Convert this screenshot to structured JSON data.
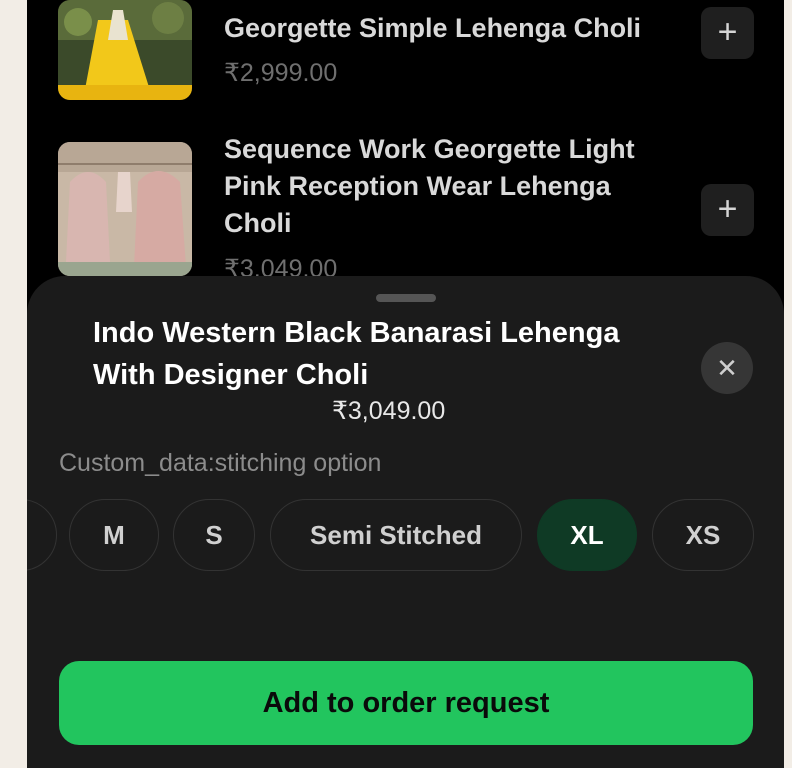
{
  "products": [
    {
      "title": "Georgette Simple Lehenga Choli",
      "price": "₹2,999.00",
      "add_icon": "plus-icon"
    },
    {
      "title": "Sequence Work Georgette Light Pink Reception Wear Lehenga Choli",
      "price": "₹3,049.00",
      "add_icon": "plus-icon"
    }
  ],
  "sheet": {
    "title": "Indo Western Black Banarasi Lehenga With Designer Choli",
    "price": "₹3,049.00",
    "close_glyph": "✕",
    "option_label": "Custom_data:stitching option",
    "options": [
      "",
      "M",
      "S",
      "Semi Stitched",
      "XL",
      "XS"
    ],
    "selected_option": "XL",
    "cta_label": "Add to order request"
  },
  "colors": {
    "accent": "#22c55e",
    "selected_chip": "#0f3a25",
    "sheet_bg": "#1b1b1b",
    "page_bg": "#000000"
  },
  "glyphs": {
    "plus": "+"
  }
}
